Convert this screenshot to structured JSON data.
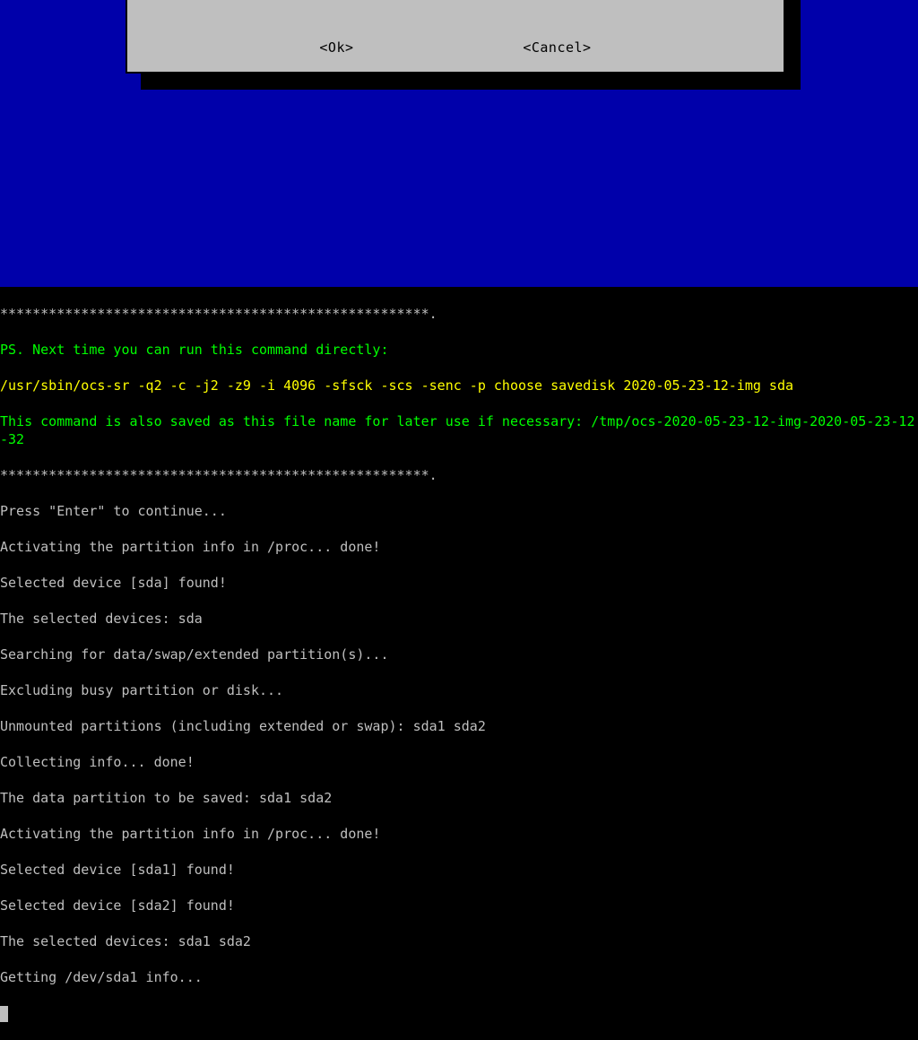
{
  "dialog": {
    "ok_label": "<Ok>",
    "cancel_label": "<Cancel>"
  },
  "terminal": {
    "sep1": "*****************************************************.",
    "ps_line": "PS. Next time you can run this command directly:",
    "cmd": "/usr/sbin/ocs-sr -q2 -c -j2 -z9 -i 4096 -sfsck -scs -senc -p choose savedisk 2020-05-23-12-img sda",
    "saved_as": "This command is also saved as this file name for later use if necessary: /tmp/ocs-2020-05-23-12-img-2020-05-23-12-32",
    "sep2": "*****************************************************.",
    "press_enter": "Press \"Enter\" to continue...",
    "activating1": "Activating the partition info in /proc... done!",
    "found_sda": "Selected device [sda] found!",
    "selected_devices": "The selected devices: sda",
    "searching": "Searching for data/swap/extended partition(s)...",
    "excluding": "Excluding busy partition or disk...",
    "unmounted": "Unmounted partitions (including extended or swap): sda1 sda2",
    "collecting": "Collecting info... done!",
    "to_be_saved": "The data partition to be saved: sda1 sda2",
    "activating2": "Activating the partition info in /proc... done!",
    "found_sda1": "Selected device [sda1] found!",
    "found_sda2": "Selected device [sda2] found!",
    "selected_devices2": "The selected devices: sda1 sda2",
    "getting": "Getting /dev/sda1 info..."
  }
}
